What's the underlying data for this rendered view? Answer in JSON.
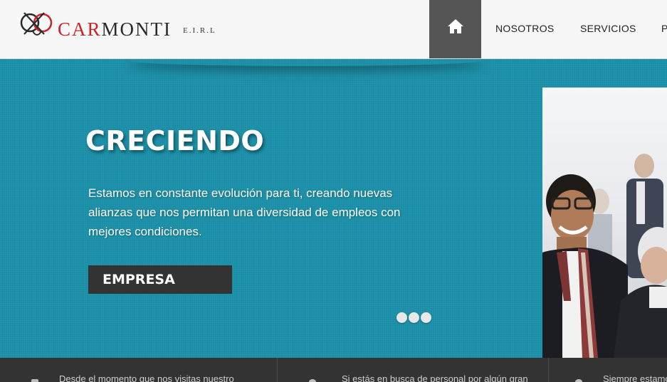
{
  "brand": {
    "name_red": "CAR",
    "name_dark": "MONTI",
    "suffix": "E.I.R.L",
    "logo_icon": "cmc-monogram-icon",
    "colors": {
      "red": "#c8252a",
      "dark": "#2a2a2a"
    }
  },
  "nav": {
    "home_icon": "home-icon",
    "items": [
      {
        "label": "NOSOTROS"
      },
      {
        "label": "SERVICIOS"
      },
      {
        "label": "P"
      }
    ],
    "colors": {
      "home_bg": "#555555",
      "header_bg": "#f7f7f7"
    }
  },
  "hero": {
    "title": "CRECIENDO",
    "description": "Estamos en constante evolución para ti, creando nuevas alianzas que nos permitan una diversidad de empleos con mejores condiciones.",
    "button_label": "EMPRESA",
    "slide_count": 3,
    "colors": {
      "background": "#1a8ea6",
      "button_bg": "#333333"
    }
  },
  "features": [
    {
      "icon": "feature-icon",
      "text": "Desde el momento que nos visitas nuestro"
    },
    {
      "icon": "feature-icon",
      "text": "Si estás en busca de personal por algún gran"
    },
    {
      "icon": "feature-icon",
      "text": "Siempre estamo"
    }
  ]
}
